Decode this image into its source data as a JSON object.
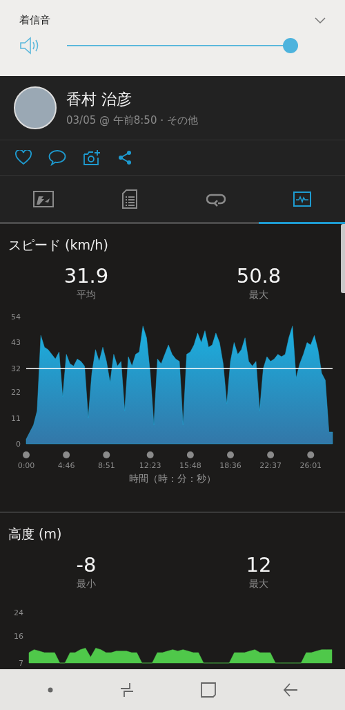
{
  "volume_panel": {
    "label": "着信音",
    "level": 1
  },
  "activity": {
    "name": "香村 治彦",
    "meta": "03/05 @ 午前8:50・その他"
  },
  "tabs": [
    {
      "kind": "map",
      "selected": false
    },
    {
      "kind": "details",
      "selected": false
    },
    {
      "kind": "laps",
      "selected": false
    },
    {
      "kind": "charts",
      "selected": true
    }
  ],
  "speed": {
    "title": "スピード (km/h)",
    "stats": [
      {
        "value": "31.9",
        "label": "平均"
      },
      {
        "value": "50.8",
        "label": "最大"
      }
    ],
    "chart_data": {
      "type": "area",
      "xlabel": "時間（時：分：秒）",
      "ylim": [
        0,
        54
      ],
      "yticks": [
        0,
        11,
        22,
        32,
        43,
        54
      ],
      "categories": [
        "0:00",
        null,
        null,
        null,
        null,
        null,
        null,
        null,
        null,
        null,
        null,
        "4:46",
        null,
        null,
        null,
        null,
        null,
        null,
        null,
        null,
        null,
        null,
        "8:51",
        null,
        null,
        null,
        null,
        null,
        null,
        null,
        null,
        null,
        null,
        null,
        "12:23",
        null,
        null,
        null,
        null,
        null,
        null,
        null,
        null,
        null,
        null,
        "15:48",
        null,
        null,
        null,
        null,
        null,
        null,
        null,
        null,
        null,
        null,
        "18:36",
        null,
        null,
        null,
        null,
        null,
        null,
        null,
        null,
        null,
        null,
        "22:37",
        null,
        null,
        null,
        null,
        null,
        null,
        null,
        null,
        null,
        null,
        "26:01",
        null,
        null,
        null,
        null,
        null,
        null
      ],
      "series": [
        {
          "color": "#1ea8d8",
          "values": [
            2,
            5,
            8,
            14,
            46,
            41,
            40,
            38,
            36,
            39,
            20,
            38,
            34,
            33,
            36,
            35,
            33,
            11,
            30,
            40,
            35,
            41,
            35,
            26,
            38,
            33,
            35,
            14,
            37,
            33,
            38,
            39,
            50,
            45,
            30,
            8,
            36,
            34,
            38,
            42,
            38,
            36,
            35,
            8,
            38,
            39,
            42,
            47,
            43,
            48,
            41,
            42,
            47,
            43,
            34,
            17,
            35,
            43,
            38,
            40,
            45,
            35,
            33,
            35,
            14,
            32,
            37,
            35,
            36,
            38,
            37,
            38,
            45,
            50,
            28,
            34,
            38,
            43,
            42,
            46,
            40,
            30,
            27,
            5,
            5
          ]
        }
      ]
    }
  },
  "altitude": {
    "title": "高度 (m)",
    "stats": [
      {
        "value": "-8",
        "label": "最小"
      },
      {
        "value": "12",
        "label": "最大"
      }
    ],
    "chart_data": {
      "type": "area",
      "ylim": [
        7,
        24
      ],
      "yticks": [
        7,
        16,
        24
      ],
      "categories": [
        null,
        null,
        null,
        null,
        null,
        null,
        null,
        null,
        null,
        null,
        null,
        null,
        null,
        null,
        null,
        null,
        null,
        null,
        null,
        null,
        null,
        null,
        null,
        null,
        null,
        null,
        null,
        null,
        null,
        null,
        null,
        null,
        null,
        null,
        null,
        null,
        null,
        null,
        null,
        null,
        null,
        null,
        null,
        null,
        null,
        null,
        null,
        null,
        null,
        null,
        null,
        null,
        null,
        null,
        null,
        null,
        null,
        null,
        null,
        null
      ],
      "series": [
        {
          "color": "#4fc84a",
          "values": [
            10.5,
            11.5,
            11,
            10.5,
            10.5,
            10.5,
            7,
            7,
            10.5,
            10.5,
            11.5,
            12,
            9,
            12,
            11.5,
            10.5,
            10.5,
            11,
            11,
            11,
            10.5,
            10.5,
            7,
            7,
            7,
            10.5,
            10.5,
            11,
            11.5,
            11,
            11.5,
            11,
            10.5,
            10.5,
            7,
            7,
            7,
            7,
            7,
            7,
            10.5,
            10.5,
            10.5,
            11,
            11.5,
            10.5,
            10.5,
            10.5,
            7,
            7,
            7,
            7,
            7,
            7,
            10.5,
            10.5,
            11,
            11.5,
            11.5,
            11.5
          ]
        }
      ]
    }
  }
}
